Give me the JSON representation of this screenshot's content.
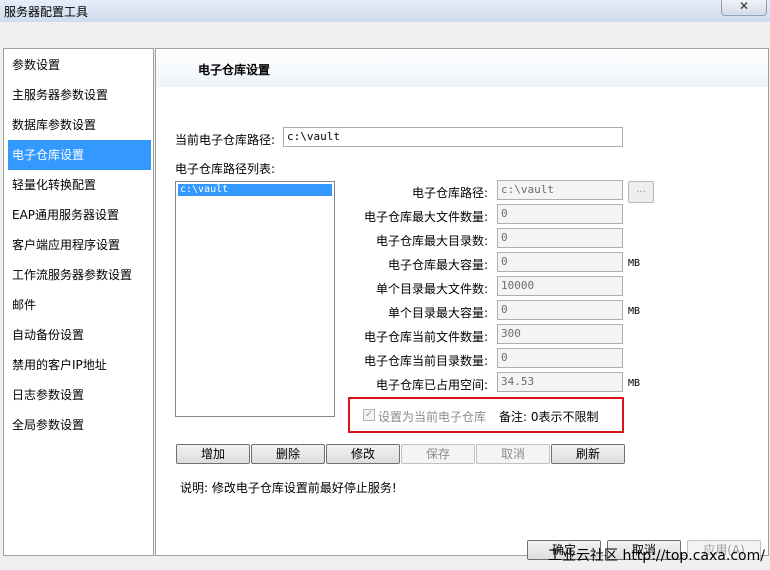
{
  "window": {
    "title": "服务器配置工具",
    "close_glyph": "✕"
  },
  "sidebar": {
    "items": [
      {
        "label": "参数设置"
      },
      {
        "label": "主服务器参数设置"
      },
      {
        "label": "数据库参数设置"
      },
      {
        "label": "电子仓库设置"
      },
      {
        "label": "轻量化转换配置"
      },
      {
        "label": "EAP通用服务器设置"
      },
      {
        "label": "客户端应用程序设置"
      },
      {
        "label": "工作流服务器参数设置"
      },
      {
        "label": "邮件"
      },
      {
        "label": "自动备份设置"
      },
      {
        "label": "禁用的客户IP地址"
      },
      {
        "label": "日志参数设置"
      },
      {
        "label": "全局参数设置"
      }
    ],
    "selected_index": 3
  },
  "content": {
    "section_title": "电子仓库设置",
    "current_path_label": "当前电子仓库路径:",
    "current_path_value": "c:\\vault",
    "list_label": "电子仓库路径列表:",
    "list_items": [
      "c:\\vault"
    ],
    "fields": [
      {
        "label": "电子仓库路径:",
        "value": "c:\\vault",
        "unit": ""
      },
      {
        "label": "电子仓库最大文件数量:",
        "value": "0",
        "unit": ""
      },
      {
        "label": "电子仓库最大目录数:",
        "value": "0",
        "unit": ""
      },
      {
        "label": "电子仓库最大容量:",
        "value": "0",
        "unit": "MB"
      },
      {
        "label": "单个目录最大文件数:",
        "value": "10000",
        "unit": ""
      },
      {
        "label": "单个目录最大容量:",
        "value": "0",
        "unit": "MB"
      },
      {
        "label": "电子仓库当前文件数量:",
        "value": "300",
        "unit": ""
      },
      {
        "label": "电子仓库当前目录数量:",
        "value": "0",
        "unit": ""
      },
      {
        "label": "电子仓库已占用空间:",
        "value": "34.53",
        "unit": "MB"
      }
    ],
    "browse_label": "...",
    "checkbox_label": "设置为当前电子仓库",
    "checkbox_checked": true,
    "note": "备注: 0表示不限制",
    "buttons": [
      {
        "label": "增加",
        "enabled": true
      },
      {
        "label": "删除",
        "enabled": true
      },
      {
        "label": "修改",
        "enabled": true
      },
      {
        "label": "保存",
        "enabled": false
      },
      {
        "label": "取消",
        "enabled": false
      },
      {
        "label": "刷新",
        "enabled": true
      }
    ],
    "instruction": "说明: 修改电子仓库设置前最好停止服务!"
  },
  "footer": {
    "ok_label": "确定",
    "cancel_label": "取消",
    "apply_label": "应用(A)",
    "watermark": "工业云社区 http://top.caxa.com/"
  },
  "colors": {
    "selection": "#3399ff",
    "highlight_box": "#d9131c"
  }
}
